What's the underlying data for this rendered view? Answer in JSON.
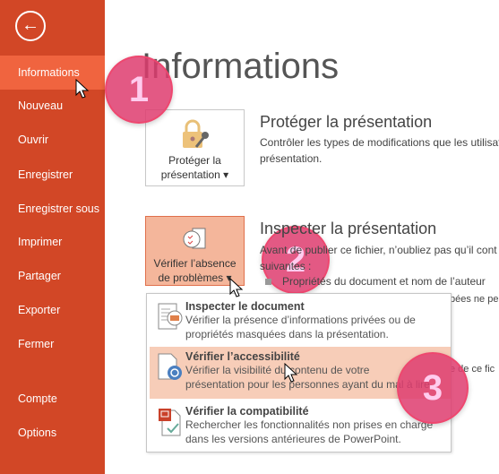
{
  "sidebar": {
    "items": [
      {
        "label": "Informations",
        "selected": true
      },
      {
        "label": "Nouveau"
      },
      {
        "label": "Ouvrir"
      },
      {
        "label": "Enregistrer"
      },
      {
        "label": "Enregistrer sous"
      },
      {
        "label": "Imprimer"
      },
      {
        "label": "Partager"
      },
      {
        "label": "Exporter"
      },
      {
        "label": "Fermer"
      },
      {
        "label": "Compte"
      },
      {
        "label": "Options"
      }
    ]
  },
  "main": {
    "title": "Informations",
    "protect": {
      "button_line1": "Protéger la",
      "button_line2": "présentation ▾",
      "heading": "Protéger la présentation",
      "desc1": "Contrôler les types de modifications que les utilisat",
      "desc2": "présentation."
    },
    "inspect": {
      "button_line1": "Vérifier l’absence",
      "button_line2": "de problèmes ▾",
      "heading": "Inspecter la présentation",
      "desc1": "Avant de publier ce fichier, n’oubliez pas qu’il cont",
      "desc2": "suivantes :",
      "bullet1": "Propriétés du document et nom de l’auteur",
      "partial1": "pées ne pe",
      "partial2": "e de ce fic"
    }
  },
  "menu": {
    "items": [
      {
        "title": "Inspecter le document",
        "desc1": "Vérifier la présence d’informations privées ou de",
        "desc2": "propriétés masquées dans la présentation.",
        "icon": "inspect-document-icon"
      },
      {
        "title": "Vérifier l’accessibilité",
        "desc1": "Vérifier la visibilité du contenu de votre",
        "desc2": "présentation pour les personnes ayant du mal à lire.",
        "icon": "accessibility-icon",
        "highlighted": true
      },
      {
        "title": "Vérifier la compatibilité",
        "desc1": "Rechercher les fonctionnalités non prises en charge",
        "desc2": "dans les versions antérieures de PowerPoint.",
        "icon": "compatibility-icon"
      }
    ]
  },
  "badges": [
    "1",
    "2",
    "3"
  ],
  "colors": {
    "sidebar": "#D24726",
    "selected": "#F0643F",
    "badge": "#DE3C6E",
    "highlight": "#F7CDB8"
  }
}
